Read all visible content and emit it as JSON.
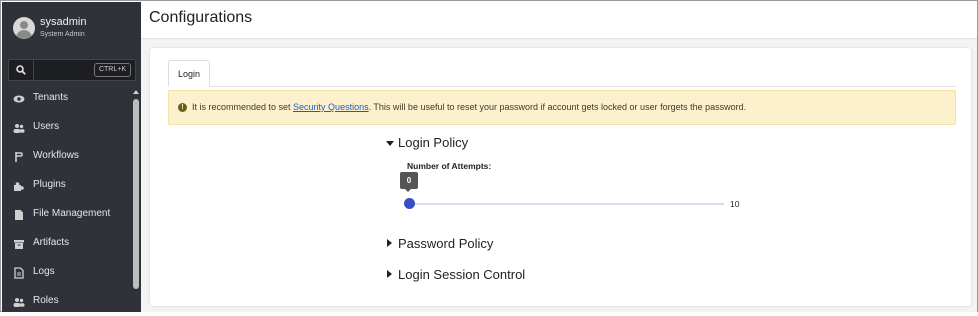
{
  "user": {
    "name": "sysadmin",
    "role": "System Admin"
  },
  "search": {
    "shortcut": "CTRL+K"
  },
  "sidebar": {
    "items": [
      {
        "label": "Tenants",
        "icon": "eye-icon"
      },
      {
        "label": "Users",
        "icon": "users-icon"
      },
      {
        "label": "Workflows",
        "icon": "workflow-icon"
      },
      {
        "label": "Plugins",
        "icon": "puzzle-icon"
      },
      {
        "label": "File Management",
        "icon": "file-icon"
      },
      {
        "label": "Artifacts",
        "icon": "archive-icon"
      },
      {
        "label": "Logs",
        "icon": "document-icon"
      },
      {
        "label": "Roles",
        "icon": "users-icon"
      }
    ]
  },
  "page": {
    "title": "Configurations"
  },
  "tabs": [
    {
      "label": "Login",
      "active": true
    }
  ],
  "alert": {
    "prefix": "It is recommended to set ",
    "link": "Security Questions",
    "suffix": ". This will be useful to reset your password if account gets locked or user forgets the password."
  },
  "login_policy": {
    "title": "Login Policy",
    "expanded": true,
    "attempts": {
      "label": "Number of Attempts:",
      "value": "0",
      "max": "10"
    }
  },
  "sections": [
    {
      "title": "Password Policy",
      "expanded": false
    },
    {
      "title": "Login Session Control",
      "expanded": false
    }
  ],
  "colors": {
    "sidebar": "#2f3238",
    "accent": "#3a4ec4",
    "alert_bg": "#fcf1cc",
    "link": "#1a5ccf"
  }
}
